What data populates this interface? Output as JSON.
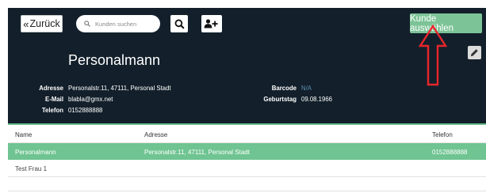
{
  "toolbar": {
    "back_label": "Zurück",
    "search_placeholder": "Kunden suchen",
    "select_customer_label": "Kunde auswählen"
  },
  "icons": {
    "back": "double-chevron-left-icon",
    "search": "search-icon",
    "magnifier_button": "search-icon",
    "add_user": "add-user-icon",
    "edit": "pencil-icon"
  },
  "customer": {
    "name": "Personalmann",
    "labels": {
      "address": "Adresse",
      "email": "E-Mail",
      "phone": "Telefon",
      "barcode": "Barcode",
      "birthday": "Geburtstag"
    },
    "address": "Personalstr.11, 47111, Personal Stadt",
    "email": "blabla@gmx.net",
    "phone": "0152888888",
    "barcode": "N/A",
    "birthday": "09.08.1966"
  },
  "table": {
    "columns": [
      "Name",
      "Adresse",
      "Telefon"
    ],
    "rows": [
      {
        "name": "Personalmann",
        "address": "Personalstr.11, 47111, Personal Stadt",
        "phone": "0152888888",
        "selected": true
      },
      {
        "name": "Test Frau 1",
        "address": "",
        "phone": "",
        "selected": false
      }
    ]
  },
  "colors": {
    "header_bg": "#13202b",
    "accent_green": "#6fc491",
    "annotation_red": "#e8252b"
  }
}
